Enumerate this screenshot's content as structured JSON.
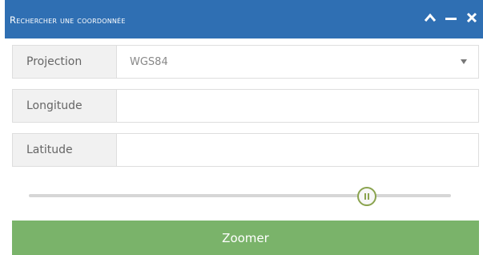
{
  "window": {
    "title": "Rechercher une coordonnée",
    "controls": [
      {
        "icon": "chevron-up-icon"
      },
      {
        "icon": "minimize-icon"
      },
      {
        "icon": "close-icon"
      }
    ],
    "title_bar_color": "#2f6fb3"
  },
  "form": {
    "projection": {
      "label": "Projection",
      "value": "WGS84"
    },
    "longitude": {
      "label": "Longitude",
      "value": ""
    },
    "latitude": {
      "label": "Latitude",
      "value": ""
    }
  },
  "slider": {
    "value_fraction": 0.8
  },
  "zoom_button": {
    "label": "Zoomer",
    "color": "#7ab36a"
  }
}
